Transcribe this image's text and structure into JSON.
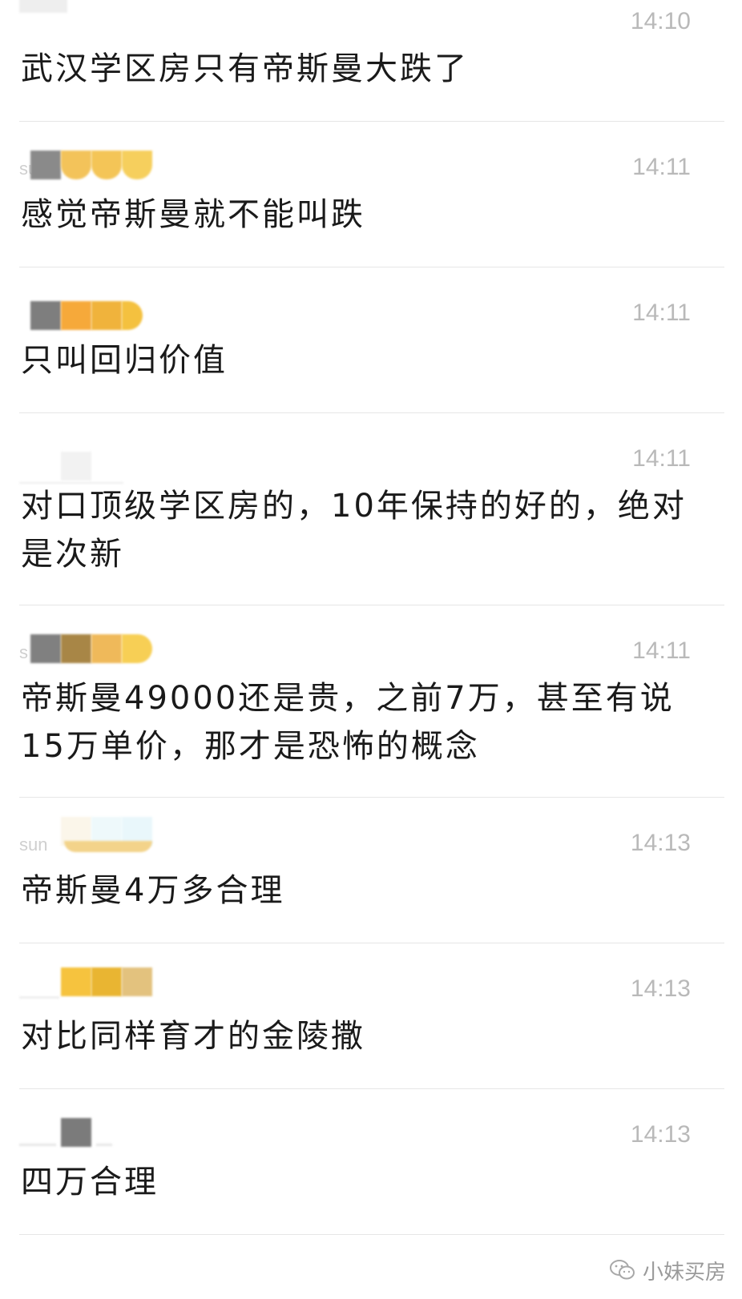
{
  "messages": [
    {
      "name_hint": "",
      "time": "14:10",
      "text": "武汉学区房只有帝斯曼大跌了"
    },
    {
      "name_hint": "sun",
      "time": "14:11",
      "text": "感觉帝斯曼就不能叫跌"
    },
    {
      "name_hint": "",
      "time": "14:11",
      "text": "只叫回归价值"
    },
    {
      "name_hint": "",
      "time": "14:11",
      "text": "对口顶级学区房的，10年保持的好的，绝对是次新"
    },
    {
      "name_hint": "s",
      "time": "14:11",
      "text": "帝斯曼49000还是贵，之前7万，甚至有说15万单价，那才是恐怖的概念"
    },
    {
      "name_hint": "sun",
      "time": "14:13",
      "text": "帝斯曼4万多合理"
    },
    {
      "name_hint": "",
      "time": "14:13",
      "text": "对比同样育才的金陵撒"
    },
    {
      "name_hint": "",
      "time": "14:13",
      "text": "四万合理"
    }
  ],
  "watermark": {
    "text": "小妹买房",
    "icon": "wechat-icon"
  },
  "colors": {
    "text": "#1a1a1a",
    "time": "#b9b9b9",
    "divider": "#e6e6e6"
  }
}
